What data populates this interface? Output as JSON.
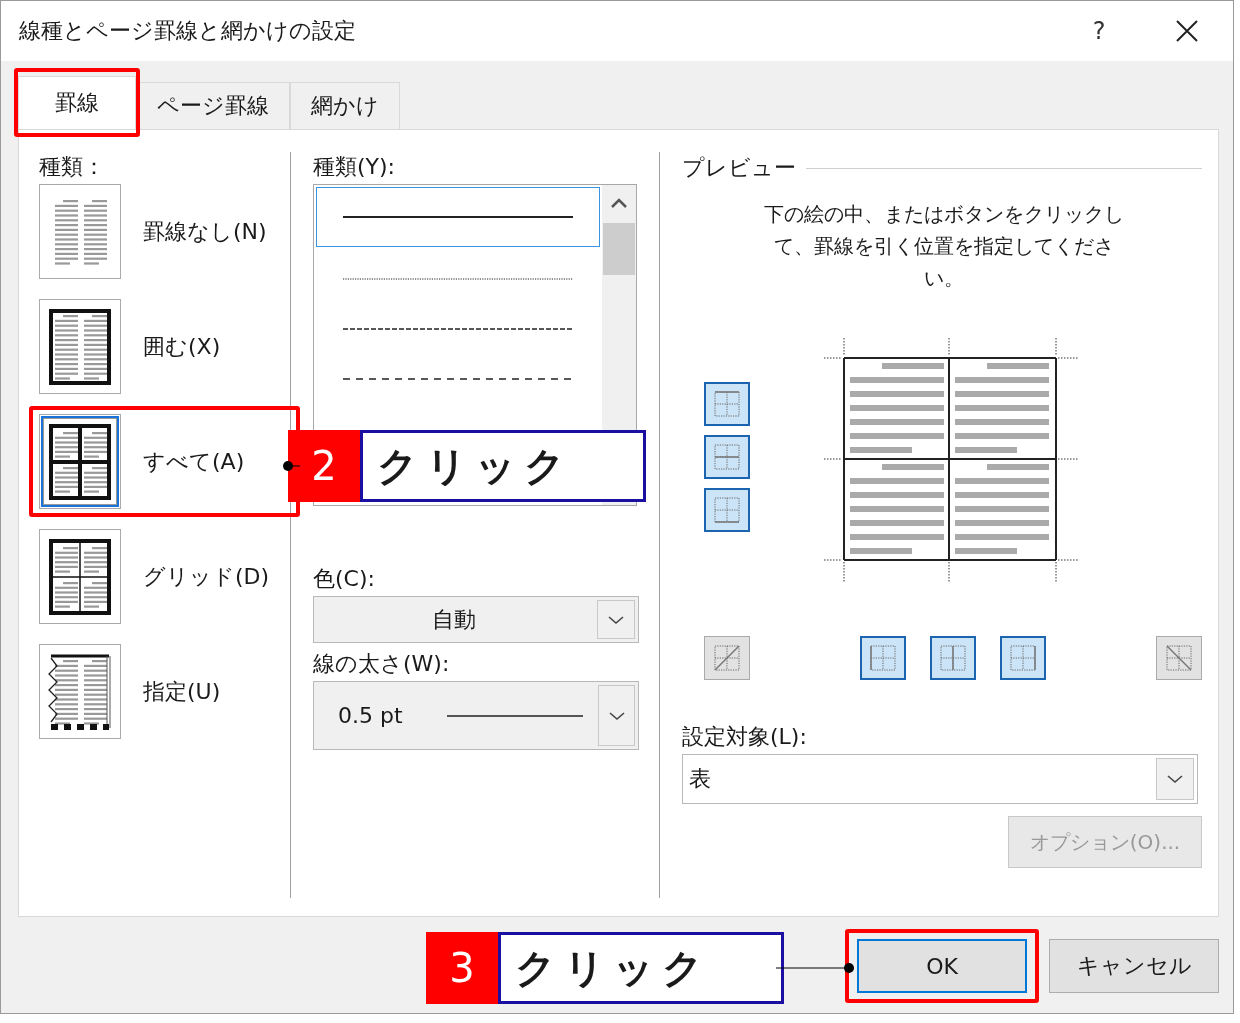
{
  "window": {
    "title": "線種とページ罫線と網かけの設定",
    "help": "?"
  },
  "tabs": [
    {
      "label": "罫線",
      "selected": true,
      "highlighted": true
    },
    {
      "label": "ページ罫線",
      "selected": false,
      "highlighted": false
    },
    {
      "label": "網かけ",
      "selected": false,
      "highlighted": false
    }
  ],
  "setting": {
    "label": "種類：",
    "items": [
      {
        "label": "罫線なし(N)",
        "kind": "none",
        "selected": false,
        "highlighted": false
      },
      {
        "label": "囲む(X)",
        "kind": "box",
        "selected": false,
        "highlighted": false
      },
      {
        "label": "すべて(A)",
        "kind": "all",
        "selected": true,
        "highlighted": true
      },
      {
        "label": "グリッド(D)",
        "kind": "grid",
        "selected": false,
        "highlighted": false
      },
      {
        "label": "指定(U)",
        "kind": "custom",
        "selected": false,
        "highlighted": false
      }
    ]
  },
  "style": {
    "label": "種類(Y):",
    "items": [
      {
        "kind": "solid",
        "selected": true
      },
      {
        "kind": "dotted",
        "selected": false
      },
      {
        "kind": "dashed",
        "selected": false
      },
      {
        "kind": "dash-wide",
        "selected": false
      }
    ]
  },
  "color": {
    "label": "色(C):",
    "value": "自動"
  },
  "line_width": {
    "label": "線の太さ(W):",
    "value": "0.5 pt"
  },
  "preview": {
    "title": "プレビュー",
    "instructions": "下の絵の中、またはボタンをクリックして、罫線を引く位置を指定してください。",
    "buttons": [
      {
        "kind": "top",
        "on": true
      },
      {
        "kind": "middle",
        "on": true
      },
      {
        "kind": "bottom",
        "on": true
      },
      {
        "kind": "diag-up",
        "on": false
      },
      {
        "kind": "left",
        "on": true
      },
      {
        "kind": "center",
        "on": true
      },
      {
        "kind": "right",
        "on": true
      },
      {
        "kind": "diag-down",
        "on": false
      }
    ]
  },
  "apply_to": {
    "label": "設定対象(L):",
    "value": "表"
  },
  "options_button": {
    "label": "オプション(O)...",
    "disabled": true
  },
  "buttons": [
    {
      "label": "OK",
      "kind": "ok",
      "highlighted": true
    },
    {
      "label": "キャンセル",
      "kind": "cancel",
      "highlighted": false
    }
  ],
  "callouts": [
    {
      "number": "2",
      "text": "クリック"
    },
    {
      "number": "3",
      "text": "クリック"
    }
  ]
}
